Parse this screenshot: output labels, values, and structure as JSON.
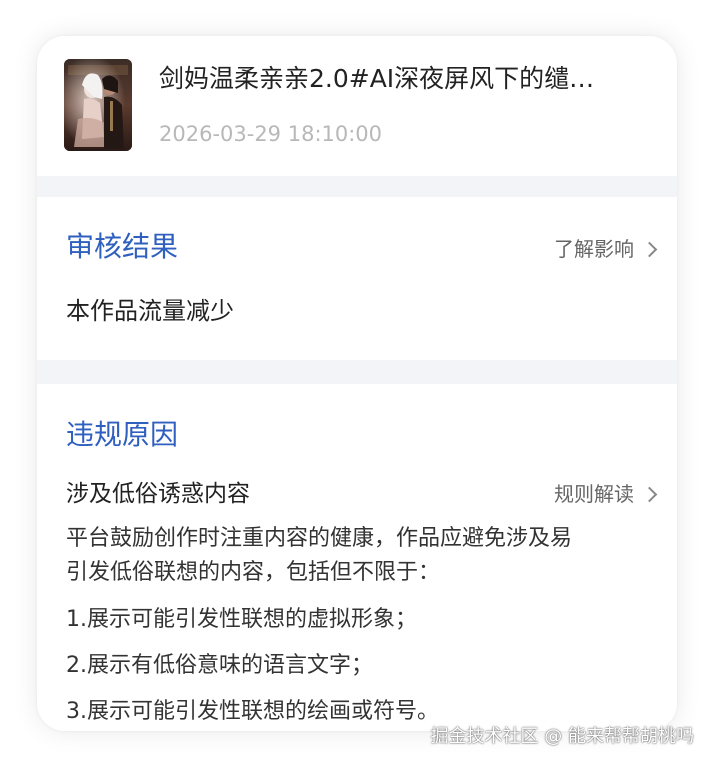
{
  "post": {
    "title": "剑妈温柔亲亲2.0#AI深夜屏风下的缱…",
    "timestamp": "2026-03-29 18:10:00"
  },
  "review": {
    "heading": "审核结果",
    "link_label": "了解影响",
    "result": "本作品流量减少"
  },
  "violation": {
    "heading": "违规原因",
    "category": "涉及低俗诱惑内容",
    "link_label": "规则解读",
    "description_lines": [
      "平台鼓励创作时注重内容的健康，作品应避免涉及易",
      "引发低俗联想的内容，包括但不限于："
    ],
    "rules": [
      "1.展示可能引发性联想的虚拟形象；",
      "2.展示有低俗意味的语言文字；",
      "3.展示可能引发性联想的绘画或符号。"
    ]
  },
  "watermark": "掘金技术社区 @ 能来帮帮胡桃吗",
  "colors": {
    "accent": "#2f5fbf",
    "section_gap": "#f3f4f8",
    "timestamp": "#b8b8b8"
  },
  "icons": {
    "link_arrow": "chevron-right-icon"
  }
}
